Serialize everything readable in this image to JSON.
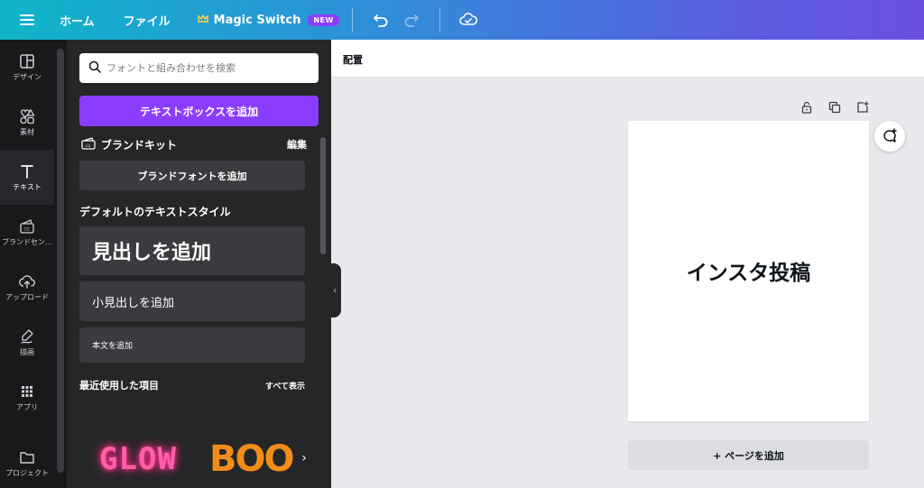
{
  "topbar": {
    "home": "ホーム",
    "file": "ファイル",
    "magic_switch": "Magic Switch",
    "new_badge": "NEW",
    "gradient_start": "#0fb5c9",
    "gradient_end": "#6a4fe2"
  },
  "rail": {
    "items": [
      {
        "label": "デザイン",
        "icon": "layout-icon"
      },
      {
        "label": "素材",
        "icon": "shapes-icon"
      },
      {
        "label": "テキスト",
        "icon": "text-icon"
      },
      {
        "label": "ブランドセン…",
        "icon": "brand-icon"
      },
      {
        "label": "アップロード",
        "icon": "upload-icon"
      },
      {
        "label": "描画",
        "icon": "draw-icon"
      },
      {
        "label": "アプリ",
        "icon": "apps-icon"
      },
      {
        "label": "プロジェクト",
        "icon": "folder-icon"
      }
    ],
    "active_index": 2
  },
  "panel": {
    "search_placeholder": "フォントと組み合わせを検索",
    "add_textbox": "テキストボックスを追加",
    "brand_kit": "ブランドキット",
    "edit": "編集",
    "add_brand_font": "ブランドフォントを追加",
    "default_styles": "デフォルトのテキストスタイル",
    "add_heading": "見出しを追加",
    "add_subheading": "小見出しを追加",
    "add_body": "本文を追加",
    "recent": "最近使用した項目",
    "show_all": "すべて表示",
    "thumb_glow": "GLOW",
    "thumb_boo": "BOO",
    "accent_color": "#8b3dff"
  },
  "canvas": {
    "arrange": "配置",
    "page_text": "インスタ投稿",
    "add_page": "+ ページを追加"
  }
}
